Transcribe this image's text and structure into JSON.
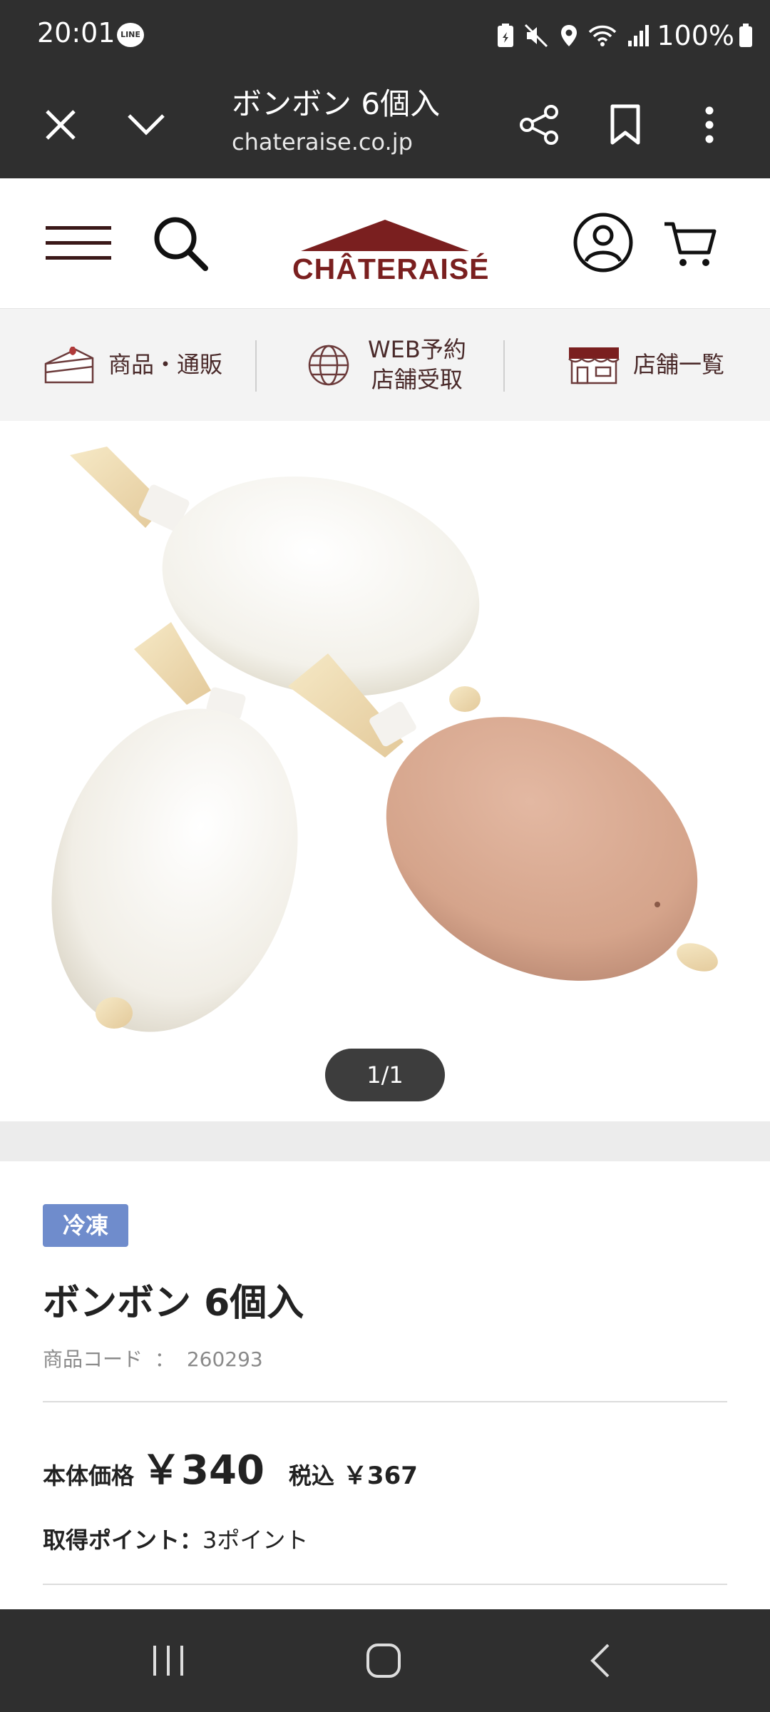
{
  "status_bar": {
    "time": "20:01",
    "line_badge": "LINE",
    "battery": "100%"
  },
  "browser": {
    "title": "ボンボン 6個入",
    "url": "chateraise.co.jp"
  },
  "site": {
    "logo_text": "CHÂTERAISÉ",
    "brand_color": "#7a1f1f"
  },
  "category_nav": {
    "items": [
      {
        "label": "商品・通販",
        "icon": "cake-icon"
      },
      {
        "label_line1": "WEB予約",
        "label_line2": "店舗受取",
        "icon": "globe-icon"
      },
      {
        "label": "店舗一覧",
        "icon": "store-icon"
      }
    ]
  },
  "gallery": {
    "counter": "1/1"
  },
  "product": {
    "badge": "冷凍",
    "badge_color": "#6f8ccc",
    "name": "ボンボン 6個入",
    "code_label": "商品コード",
    "code_sep": "：",
    "code": "260293",
    "price_label": "本体価格",
    "price": "￥340",
    "tax_label": "税込",
    "tax_price": "￥367",
    "points_label": "取得ポイント：",
    "points_value": "3ポイント"
  }
}
